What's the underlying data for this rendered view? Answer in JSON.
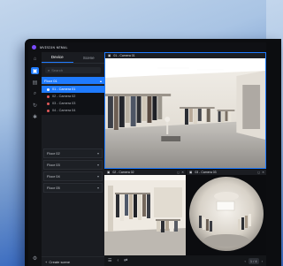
{
  "app": {
    "title": "ᴍᴠɪsɪᴏɴ ɴᴇᴍᴀʟ"
  },
  "rail": {
    "icons": [
      "home-icon",
      "camera-icon",
      "image-icon",
      "search-icon",
      "playback-icon",
      "settings-icon"
    ],
    "active_index": 1,
    "bottom_icon": "gear-icon"
  },
  "panel": {
    "tabs": [
      {
        "label": "Device",
        "active": true
      },
      {
        "label": "Scene",
        "active": false
      }
    ],
    "search_placeholder": "Search",
    "floor_open": {
      "label": "Floor 01"
    },
    "cameras": [
      {
        "label": "01 - Camera 01",
        "color": "#1f7bff",
        "selected": true
      },
      {
        "label": "02 - Camera 02",
        "color": "#e25a5a",
        "selected": false
      },
      {
        "label": "03 - Camera 03",
        "color": "#e25a5a",
        "selected": false
      },
      {
        "label": "04 - Camera 04",
        "color": "#e25a5a",
        "selected": false
      }
    ],
    "floors": [
      {
        "label": "Floor 02"
      },
      {
        "label": "Floor 03"
      },
      {
        "label": "Floor 04"
      },
      {
        "label": "Floor 05"
      }
    ],
    "footer_label": "Create scene"
  },
  "views": {
    "cam1": {
      "label": "01 - Camera 01"
    },
    "cam2": {
      "label": "02 - Camera 02"
    },
    "cam3": {
      "label": "03 - Camera 03"
    }
  },
  "bottombar": {
    "page": "1 / 4"
  },
  "colors": {
    "accent": "#1f7bff",
    "alert": "#e25a5a"
  }
}
